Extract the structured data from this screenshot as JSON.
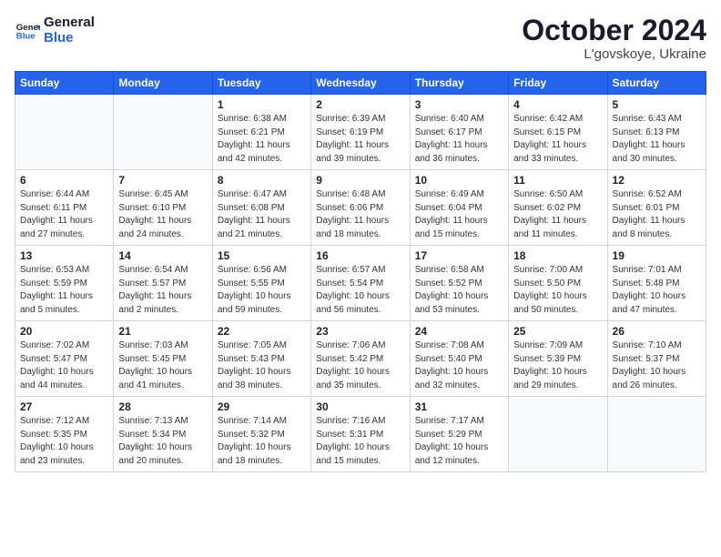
{
  "logo": {
    "line1": "General",
    "line2": "Blue"
  },
  "title": "October 2024",
  "location": "L'govskoye, Ukraine",
  "days_header": [
    "Sunday",
    "Monday",
    "Tuesday",
    "Wednesday",
    "Thursday",
    "Friday",
    "Saturday"
  ],
  "weeks": [
    [
      {
        "day": "",
        "content": ""
      },
      {
        "day": "",
        "content": ""
      },
      {
        "day": "1",
        "content": "Sunrise: 6:38 AM\nSunset: 6:21 PM\nDaylight: 11 hours\nand 42 minutes."
      },
      {
        "day": "2",
        "content": "Sunrise: 6:39 AM\nSunset: 6:19 PM\nDaylight: 11 hours\nand 39 minutes."
      },
      {
        "day": "3",
        "content": "Sunrise: 6:40 AM\nSunset: 6:17 PM\nDaylight: 11 hours\nand 36 minutes."
      },
      {
        "day": "4",
        "content": "Sunrise: 6:42 AM\nSunset: 6:15 PM\nDaylight: 11 hours\nand 33 minutes."
      },
      {
        "day": "5",
        "content": "Sunrise: 6:43 AM\nSunset: 6:13 PM\nDaylight: 11 hours\nand 30 minutes."
      }
    ],
    [
      {
        "day": "6",
        "content": "Sunrise: 6:44 AM\nSunset: 6:11 PM\nDaylight: 11 hours\nand 27 minutes."
      },
      {
        "day": "7",
        "content": "Sunrise: 6:45 AM\nSunset: 6:10 PM\nDaylight: 11 hours\nand 24 minutes."
      },
      {
        "day": "8",
        "content": "Sunrise: 6:47 AM\nSunset: 6:08 PM\nDaylight: 11 hours\nand 21 minutes."
      },
      {
        "day": "9",
        "content": "Sunrise: 6:48 AM\nSunset: 6:06 PM\nDaylight: 11 hours\nand 18 minutes."
      },
      {
        "day": "10",
        "content": "Sunrise: 6:49 AM\nSunset: 6:04 PM\nDaylight: 11 hours\nand 15 minutes."
      },
      {
        "day": "11",
        "content": "Sunrise: 6:50 AM\nSunset: 6:02 PM\nDaylight: 11 hours\nand 11 minutes."
      },
      {
        "day": "12",
        "content": "Sunrise: 6:52 AM\nSunset: 6:01 PM\nDaylight: 11 hours\nand 8 minutes."
      }
    ],
    [
      {
        "day": "13",
        "content": "Sunrise: 6:53 AM\nSunset: 5:59 PM\nDaylight: 11 hours\nand 5 minutes."
      },
      {
        "day": "14",
        "content": "Sunrise: 6:54 AM\nSunset: 5:57 PM\nDaylight: 11 hours\nand 2 minutes."
      },
      {
        "day": "15",
        "content": "Sunrise: 6:56 AM\nSunset: 5:55 PM\nDaylight: 10 hours\nand 59 minutes."
      },
      {
        "day": "16",
        "content": "Sunrise: 6:57 AM\nSunset: 5:54 PM\nDaylight: 10 hours\nand 56 minutes."
      },
      {
        "day": "17",
        "content": "Sunrise: 6:58 AM\nSunset: 5:52 PM\nDaylight: 10 hours\nand 53 minutes."
      },
      {
        "day": "18",
        "content": "Sunrise: 7:00 AM\nSunset: 5:50 PM\nDaylight: 10 hours\nand 50 minutes."
      },
      {
        "day": "19",
        "content": "Sunrise: 7:01 AM\nSunset: 5:48 PM\nDaylight: 10 hours\nand 47 minutes."
      }
    ],
    [
      {
        "day": "20",
        "content": "Sunrise: 7:02 AM\nSunset: 5:47 PM\nDaylight: 10 hours\nand 44 minutes."
      },
      {
        "day": "21",
        "content": "Sunrise: 7:03 AM\nSunset: 5:45 PM\nDaylight: 10 hours\nand 41 minutes."
      },
      {
        "day": "22",
        "content": "Sunrise: 7:05 AM\nSunset: 5:43 PM\nDaylight: 10 hours\nand 38 minutes."
      },
      {
        "day": "23",
        "content": "Sunrise: 7:06 AM\nSunset: 5:42 PM\nDaylight: 10 hours\nand 35 minutes."
      },
      {
        "day": "24",
        "content": "Sunrise: 7:08 AM\nSunset: 5:40 PM\nDaylight: 10 hours\nand 32 minutes."
      },
      {
        "day": "25",
        "content": "Sunrise: 7:09 AM\nSunset: 5:39 PM\nDaylight: 10 hours\nand 29 minutes."
      },
      {
        "day": "26",
        "content": "Sunrise: 7:10 AM\nSunset: 5:37 PM\nDaylight: 10 hours\nand 26 minutes."
      }
    ],
    [
      {
        "day": "27",
        "content": "Sunrise: 7:12 AM\nSunset: 5:35 PM\nDaylight: 10 hours\nand 23 minutes."
      },
      {
        "day": "28",
        "content": "Sunrise: 7:13 AM\nSunset: 5:34 PM\nDaylight: 10 hours\nand 20 minutes."
      },
      {
        "day": "29",
        "content": "Sunrise: 7:14 AM\nSunset: 5:32 PM\nDaylight: 10 hours\nand 18 minutes."
      },
      {
        "day": "30",
        "content": "Sunrise: 7:16 AM\nSunset: 5:31 PM\nDaylight: 10 hours\nand 15 minutes."
      },
      {
        "day": "31",
        "content": "Sunrise: 7:17 AM\nSunset: 5:29 PM\nDaylight: 10 hours\nand 12 minutes."
      },
      {
        "day": "",
        "content": ""
      },
      {
        "day": "",
        "content": ""
      }
    ]
  ]
}
